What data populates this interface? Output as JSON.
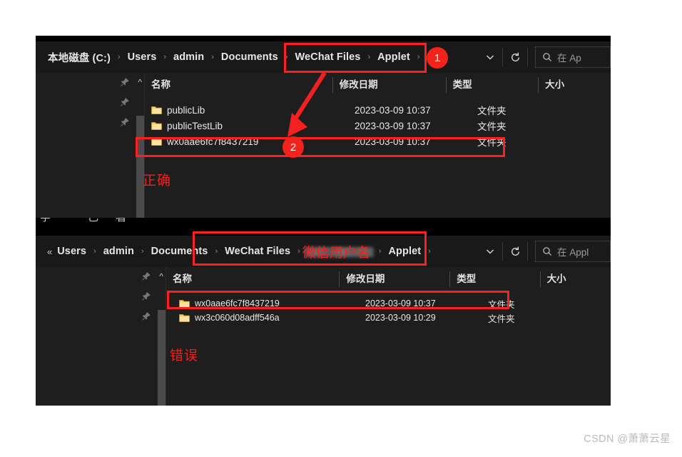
{
  "colors": {
    "annotation_red": "#fc2020",
    "badge_red": "#f2231b",
    "window_bg": "#1e1e1e",
    "addressbar_bg": "#191919",
    "folder_yellow": "#f0c14b",
    "text_primary": "#e8e8e8"
  },
  "top_window": {
    "breadcrumb": [
      {
        "label": "本地磁盘 (C:)",
        "sep": "›"
      },
      {
        "label": "Users",
        "sep": "›"
      },
      {
        "label": "admin",
        "sep": "›"
      },
      {
        "label": "Documents",
        "sep": "›"
      },
      {
        "label": "WeChat Files",
        "sep": "›"
      },
      {
        "label": "Applet",
        "sep": "›"
      }
    ],
    "dropdown_icon": "chevron-down-icon",
    "refresh_icon": "refresh-icon",
    "search": {
      "placeholder": "在 Ap",
      "icon": "search-icon"
    },
    "columns": [
      "名称",
      "修改日期",
      "类型",
      "大小"
    ],
    "rows": [
      {
        "name": "publicLib",
        "date": "2023-03-09 10:37",
        "type": "文件夹",
        "size": ""
      },
      {
        "name": "publicTestLib",
        "date": "2023-03-09 10:37",
        "type": "文件夹",
        "size": ""
      },
      {
        "name": "wx0aae6fc7f8437219",
        "date": "2023-03-09 10:37",
        "type": "文件夹",
        "size": ""
      }
    ],
    "annotations": {
      "badge_1": "1",
      "badge_2": "2",
      "verdict": "正确"
    }
  },
  "bottom_window": {
    "breadcrumb": [
      {
        "label": "«",
        "sep": ""
      },
      {
        "label": "Users",
        "sep": "›"
      },
      {
        "label": "admin",
        "sep": "›"
      },
      {
        "label": "Documents",
        "sep": "›"
      },
      {
        "label": "WeChat Files",
        "sep": "›"
      },
      {
        "label": "微信用户名",
        "sep": "›",
        "redacted": true
      },
      {
        "label": "Applet",
        "sep": "›"
      }
    ],
    "dropdown_icon": "chevron-down-icon",
    "refresh_icon": "refresh-icon",
    "search": {
      "placeholder": "在 Appl",
      "icon": "search-icon"
    },
    "columns": [
      "名称",
      "修改日期",
      "类型",
      "大小"
    ],
    "rows": [
      {
        "name": "wx0aae6fc7f8437219",
        "date": "2023-03-09 10:37",
        "type": "文件夹",
        "size": ""
      },
      {
        "name": "wx3c060d08adff546a",
        "date": "2023-03-09 10:29",
        "type": "文件夹",
        "size": ""
      }
    ],
    "annotations": {
      "verdict": "错误"
    }
  },
  "clipped_sliver_text": "字  已看",
  "watermark": "CSDN @萧萧云星"
}
